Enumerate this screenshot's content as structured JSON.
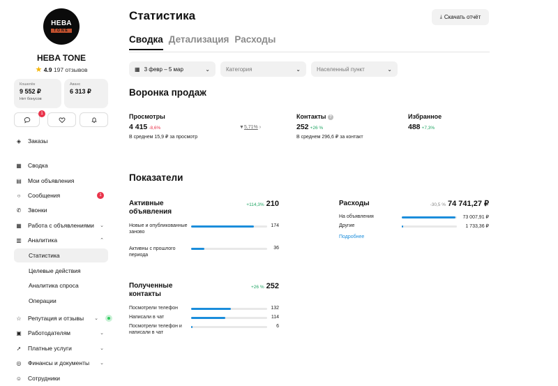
{
  "sidebar": {
    "logo": {
      "main": "НЕВА",
      "sub": "TONE"
    },
    "profile_name": "HEBA TONE",
    "rating": "4.9",
    "reviews": "197 отзывов",
    "wallet": {
      "label": "Кошелёк",
      "value": "9 552 ₽",
      "sub": "Нет бонусов"
    },
    "advance": {
      "label": "Аванс",
      "value": "6 313 ₽"
    },
    "messages_badge": "1",
    "nav": {
      "orders": "Заказы",
      "summary": "Сводка",
      "my_ads": "Мои объявления",
      "messages": "Сообщения",
      "messages_badge": "1",
      "calls": "Звонки",
      "ads_work": "Работа с объявлениями",
      "analytics": "Аналитика",
      "statistics": "Статистика",
      "target_actions": "Целевые действия",
      "demand_analytics": "Аналитика спроса",
      "operations": "Операции",
      "reputation": "Репутация и отзывы",
      "employers": "Работодателям",
      "paid_services": "Платные услуги",
      "finance": "Финансы и документы",
      "employees": "Сотрудники"
    }
  },
  "header": {
    "title": "Статистика",
    "download": "Скачать отчёт"
  },
  "tabs": [
    "Сводка",
    "Детализация",
    "Расходы"
  ],
  "filters": {
    "date": "3 февр – 5 мар",
    "category": "Категория",
    "location": "Населенный пункт"
  },
  "funnel": {
    "title": "Воронка продаж",
    "views": {
      "label": "Просмотры",
      "value": "4 415",
      "delta": "-8,6%",
      "sub": "В среднем 15,9 ₽ за просмотр"
    },
    "conversion": "5,71%",
    "contacts": {
      "label": "Контакты",
      "value": "252",
      "delta": "+26 %",
      "sub": "В среднем 296,6 ₽ за контакт"
    },
    "favorites": {
      "label": "Избранное",
      "value": "488",
      "delta": "+7,3%"
    }
  },
  "indicators": {
    "title": "Показатели",
    "active_ads": {
      "title": "Активные объявления",
      "delta": "+114,3%",
      "value": "210",
      "rows": [
        {
          "label": "Новые и опубликованные заново",
          "value": "174",
          "fraction": 0.83
        },
        {
          "label": "Активны с прошлого периода",
          "value": "36",
          "fraction": 0.17
        }
      ]
    },
    "contacts_received": {
      "title": "Полученные контакты",
      "delta": "+26 %",
      "value": "252",
      "rows": [
        {
          "label": "Посмотрели телефон",
          "value": "132",
          "fraction": 0.52
        },
        {
          "label": "Написали в чат",
          "value": "114",
          "fraction": 0.45
        },
        {
          "label": "Посмотрели телефон и написали в чат",
          "value": "6",
          "fraction": 0.02
        }
      ]
    },
    "expenses": {
      "title": "Расходы",
      "delta": "-30,5 %",
      "value": "74 741,27 ₽",
      "rows": [
        {
          "label": "На объявления",
          "value": "73 007,91 ₽",
          "fraction": 0.98
        },
        {
          "label": "Другие",
          "value": "1 733,36 ₽",
          "fraction": 0.02
        }
      ],
      "link": "Подробнее"
    }
  },
  "colors": {
    "accent": "#1b8ddb",
    "negative": "#e9334a",
    "positive": "#1fa463",
    "badge": "#e9334a",
    "online": "#2fcb5e"
  }
}
